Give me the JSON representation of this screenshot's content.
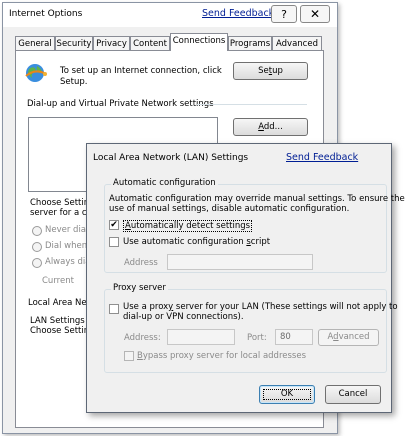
{
  "internet_options": {
    "title": "Internet Options",
    "send_feedback": "Send Feedback",
    "help_label": "?",
    "close_label": "✕",
    "tabs": [
      {
        "label": "General"
      },
      {
        "label": "Security"
      },
      {
        "label": "Privacy"
      },
      {
        "label": "Content"
      },
      {
        "label": "Connections"
      },
      {
        "label": "Programs"
      },
      {
        "label": "Advanced"
      }
    ],
    "active_tab": "Connections",
    "setup_text_1": "To set up an Internet connection, click",
    "setup_text_2": "Setup.",
    "setup_button": "Setup",
    "vpn_heading": "Dial-up and Virtual Private Network settings",
    "add_button": "Add...",
    "choose_partial_1": "Choose Setting",
    "choose_partial_2": "server for a co",
    "radio_never": "Never dial",
    "radio_dial_when": "Dial whene",
    "radio_always": "Always dial",
    "current_label": "Current",
    "lan_heading_partial": "Local Area Netw",
    "lan_settings_partial_1": "LAN Settings d",
    "lan_settings_partial_2": "Choose Settin"
  },
  "lan_dialog": {
    "title": "Local Area Network (LAN) Settings",
    "send_feedback": "Send Feedback",
    "auto_config": {
      "group_title": "Automatic configuration",
      "description_1": "Automatic configuration may override manual settings.  To ensure the",
      "description_2": "use of manual settings, disable automatic configuration.",
      "auto_detect_label": "Automatically detect settings",
      "auto_detect_checked": true,
      "script_label": "Use automatic configuration script",
      "script_checked": false,
      "address_label": "Address",
      "address_value": ""
    },
    "proxy": {
      "group_title": "Proxy server",
      "use_proxy_label_1": "Use a proxy server for your LAN (These settings will not apply to",
      "use_proxy_label_2": "dial-up or VPN connections).",
      "use_proxy_checked": false,
      "address_label": "Address:",
      "address_value": "",
      "port_label": "Port:",
      "port_value": "80",
      "advanced_button": "Advanced",
      "bypass_label": "Bypass proxy server for local addresses",
      "bypass_checked": false
    },
    "ok_button": "OK",
    "cancel_button": "Cancel"
  }
}
